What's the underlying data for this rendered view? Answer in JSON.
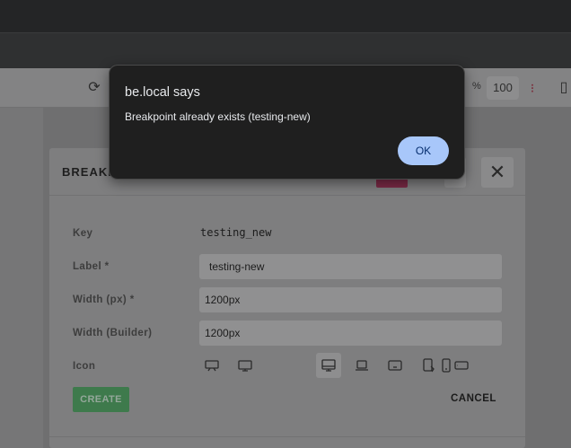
{
  "dialog": {
    "title": "be.local says",
    "message": "Breakpoint already exists (testing-new)",
    "ok_label": "OK"
  },
  "toolbar": {
    "zoom_unit": "%",
    "zoom_value": "100"
  },
  "modal": {
    "title": "BREAKP",
    "fields": {
      "key": {
        "label": "Key",
        "value": "testing_new"
      },
      "label": {
        "label": "Label *",
        "value": "testing-new"
      },
      "width": {
        "label": "Width (px) *",
        "value": "1200px"
      },
      "width_builder": {
        "label": "Width (Builder)",
        "value": "1200px"
      },
      "icon": {
        "label": "Icon"
      }
    },
    "icons": [
      "desktop-wide-icon",
      "monitor-icon",
      "desktop-icon",
      "laptop-icon",
      "tablet-landscape-icon",
      "tablet-portrait-rotate-icon",
      "tablet-landscape-small-icon",
      "mobile-icon"
    ],
    "selected_icon": "desktop-icon",
    "create_label": "CREATE",
    "cancel_label": "CANCEL"
  },
  "colors": {
    "dialog_bg": "#1f1f1f",
    "ok_button": "#a8c7fa",
    "create_button": "#3e7a4c"
  }
}
